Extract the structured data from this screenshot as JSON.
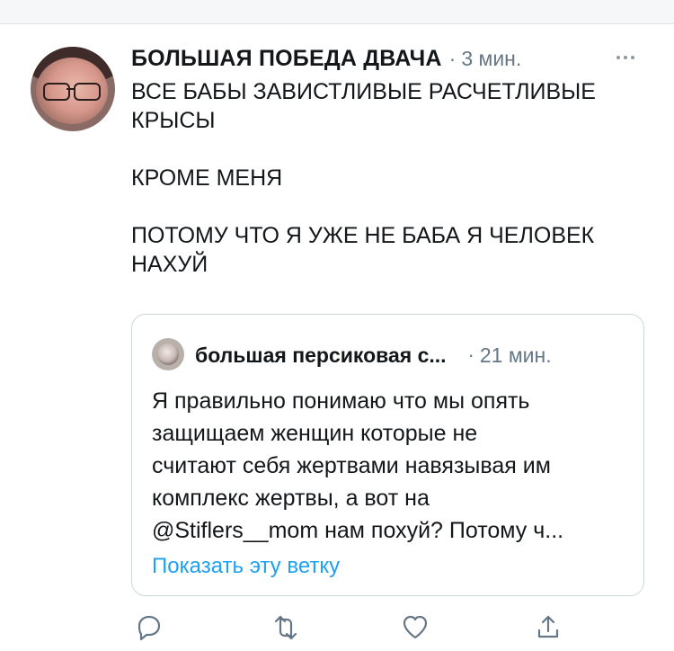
{
  "tweet": {
    "author_name": "БОЛЬШАЯ ПОБЕДА ДВАЧА",
    "separator": "·",
    "time": "3 мин.",
    "more_icon": "more-horizontal-icon",
    "text_lines": [
      "ВСЕ БАБЫ ЗАВИСТЛИВЫЕ РАСЧЕТЛИВЫЕ",
      "КРЫСЫ",
      "",
      "КРОМЕ МЕНЯ",
      "",
      "ПОТОМУ ЧТО Я УЖЕ НЕ БАБА Я ЧЕЛОВЕК",
      "НАХУЙ"
    ]
  },
  "quote": {
    "author_name": "большая персиковая с...",
    "separator": "·",
    "time": "21 мин.",
    "text_lines": [
      "Я правильно понимаю что мы опять",
      "защищаем женщин которые не",
      "считают себя жертвами навязывая им",
      "комплекс жертвы, а вот на",
      "@Stiflers__mom нам похуй? Потому ч..."
    ],
    "show_thread": "Показать эту ветку"
  },
  "actions": [
    "reply-icon",
    "retweet-icon",
    "like-icon",
    "share-icon"
  ],
  "colors": {
    "text": "#14171a",
    "secondary": "#657786",
    "link": "#1da1f2",
    "border": "#ccd6dd"
  }
}
